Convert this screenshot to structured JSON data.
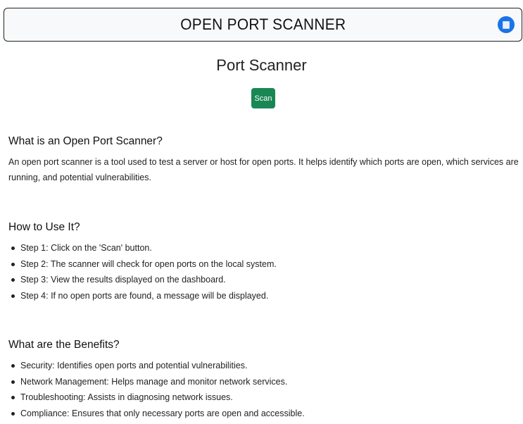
{
  "header": {
    "title": "OPEN PORT SCANNER",
    "avatar_icon": "broken-image-icon"
  },
  "main": {
    "title": "Port Scanner",
    "scan_button_label": "Scan"
  },
  "sections": {
    "what": {
      "heading": "What is an Open Port Scanner?",
      "body": "An open port scanner is a tool used to test a server or host for open ports. It helps identify which ports are open, which services are running, and potential vulnerabilities."
    },
    "how": {
      "heading": "How to Use It?",
      "items": [
        "Step 1: Click on the 'Scan' button.",
        "Step 2: The scanner will check for open ports on the local system.",
        "Step 3: View the results displayed on the dashboard.",
        "Step 4: If no open ports are found, a message will be displayed."
      ]
    },
    "benefits": {
      "heading": "What are the Benefits?",
      "items": [
        "Security: Identifies open ports and potential vulnerabilities.",
        "Network Management: Helps manage and monitor network services.",
        "Troubleshooting: Assists in diagnosing network issues.",
        "Compliance: Ensures that only necessary ports are open and accessible."
      ]
    }
  },
  "colors": {
    "scan_button": "#198754",
    "avatar": "#1a73e8"
  }
}
